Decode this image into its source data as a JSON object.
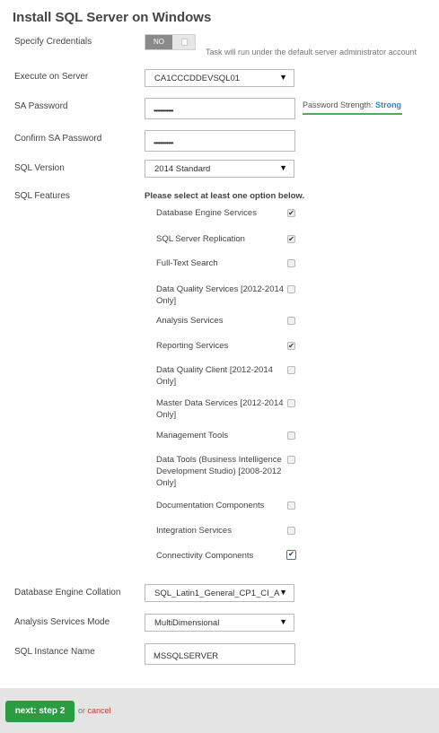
{
  "title": "Install SQL Server on Windows",
  "credentials": {
    "label": "Specify Credentials",
    "toggle_state": "NO",
    "note": "Task will run under the default server administrator account"
  },
  "execute_server": {
    "label": "Execute on Server",
    "value": "CA1CCCDDEVSQL01"
  },
  "sa_password": {
    "label": "SA Password",
    "value": "••••••••••••",
    "strength_label": "Password Strength:",
    "strength_value": "Strong"
  },
  "confirm_password": {
    "label": "Confirm SA Password",
    "value": "••••••••••••"
  },
  "sql_version": {
    "label": "SQL Version",
    "value": "2014 Standard"
  },
  "features": {
    "label": "SQL Features",
    "hint": "Please select at least one option below.",
    "items": [
      {
        "label": "Database Engine Services",
        "checked": true
      },
      {
        "label": "SQL Server Replication",
        "checked": true
      },
      {
        "label": "Full-Text Search",
        "checked": false
      },
      {
        "label": "Data Quality Services [2012-2014 Only]",
        "checked": false
      },
      {
        "label": "Analysis Services",
        "checked": false
      },
      {
        "label": "Reporting Services",
        "checked": true
      },
      {
        "label": "Data Quality Client [2012-2014 Only]",
        "checked": false
      },
      {
        "label": "Master Data Services [2012-2014 Only]",
        "checked": false
      },
      {
        "label": "Management Tools",
        "checked": false
      },
      {
        "label": "Data Tools (Business Intelligence Development Studio) [2008-2012 Only]",
        "checked": false
      },
      {
        "label": "Documentation Components",
        "checked": false
      },
      {
        "label": "Integration Services",
        "checked": false
      },
      {
        "label": "Connectivity Components",
        "checked": true
      }
    ]
  },
  "collation": {
    "label": "Database Engine Collation",
    "value": "SQL_Latin1_General_CP1_CI_A"
  },
  "analysis_mode": {
    "label": "Analysis Services Mode",
    "value": "MultiDimensional"
  },
  "instance_name": {
    "label": "SQL Instance Name",
    "value": "MSSQLSERVER"
  },
  "footer": {
    "next_label": "next: step 2",
    "or_text": "or",
    "cancel_label": "cancel"
  },
  "colors": {
    "accent_green": "#2a9d43",
    "strength_blue": "#2f86c9",
    "cancel_red": "#c0392b"
  }
}
